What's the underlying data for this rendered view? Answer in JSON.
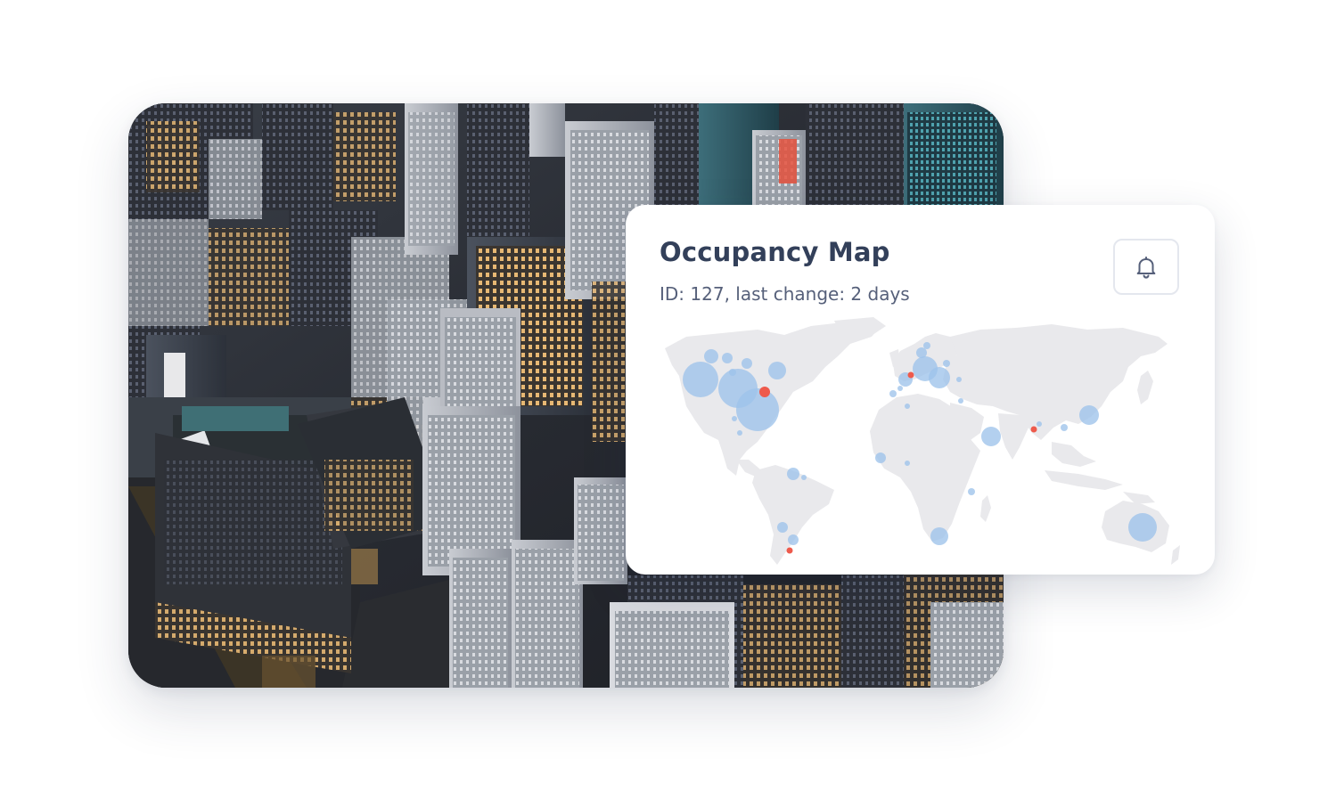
{
  "map_card": {
    "title": "Occupancy Map",
    "subtitle": "ID: 127, last change: 2 days",
    "notification_icon": "bell-icon"
  },
  "photo": {
    "subject": "aerial-city-skyline-at-dusk"
  },
  "colors": {
    "title": "#33405a",
    "subtitle": "#56607a",
    "land": "#e9e9ec",
    "marker_normal": "#9ec3ea",
    "marker_alert": "#ee5a4c"
  }
}
